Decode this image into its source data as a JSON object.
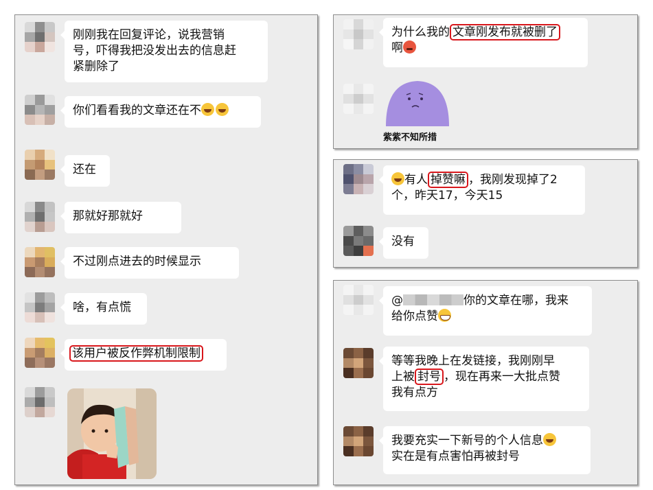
{
  "left_panel": {
    "messages": [
      {
        "text_lines": [
          "刚刚我在回复评论，说我营销",
          "号，吓得我把没发出去的信息赶",
          "紧删除了"
        ]
      },
      {
        "text": "你们看看我的文章还在不"
      },
      {
        "text": "还在"
      },
      {
        "text": "那就好那就好"
      },
      {
        "text": "不过刚点进去的时候显示"
      },
      {
        "text": "啥，有点慌"
      },
      {
        "text": "该用户被反作弊机制限制"
      }
    ],
    "last_image": "photo of a child holding shoes near face"
  },
  "panel_2": {
    "message_1": {
      "before": "为什么我的",
      "highlight": "文章刚发布就被删了",
      "line2": "啊"
    },
    "sticker_caption": "紫紫不知所措"
  },
  "panel_3": {
    "message_1": {
      "before": "有人",
      "highlight": "掉赞嘛",
      "after": "，我刚发现掉了2",
      "line2": "个，昨天17，今天15"
    },
    "message_2": "没有"
  },
  "panel_4": {
    "message_1": {
      "prefix": "@",
      "after": "你的文章在哪，我来",
      "line2": "给你点赞"
    },
    "message_2": {
      "line1": "等等我晚上在发链接，我刚刚早",
      "line2_before": "上被",
      "highlight": "封号",
      "line2_after": "，现在再来一大批点赞",
      "line3": "我有点方"
    },
    "message_3": {
      "line1": "我要充实一下新号的个人信息",
      "line2": "实在是有点害怕再被封号"
    }
  },
  "colors": {
    "panel_bg": "#ededed",
    "bubble_bg": "#ffffff",
    "highlight": "#d8161b",
    "sticker": "#a58ee0"
  }
}
